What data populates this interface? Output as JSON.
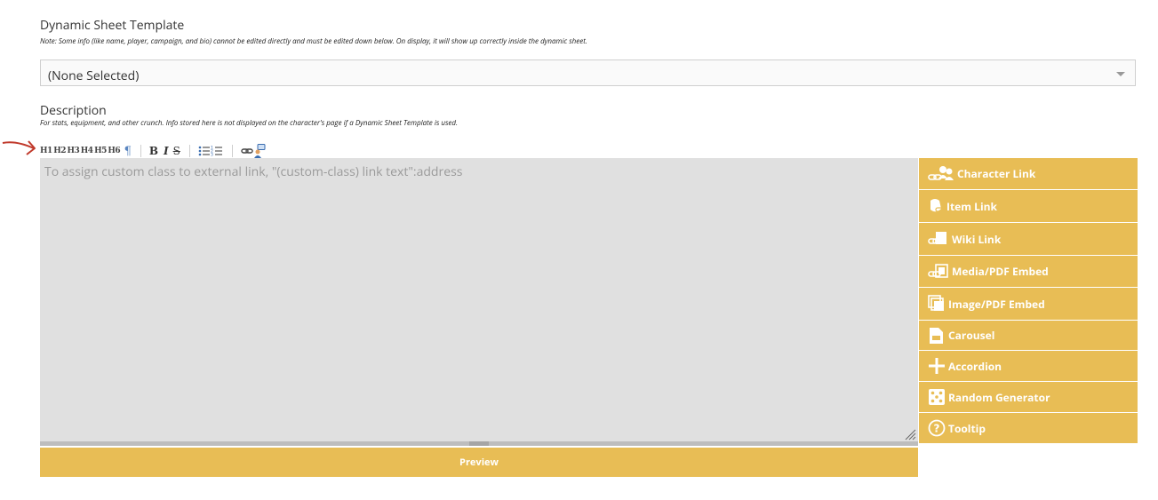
{
  "template": {
    "title": "Dynamic Sheet Template",
    "note": "Note: Some info (like name, player, campaign, and bio) cannot be edited directly and must be edited down below. On display, it will show up correctly inside the dynamic sheet.",
    "selected": "(None Selected)"
  },
  "description": {
    "title": "Description",
    "note": "For stats, equipment, and other crunch. Info stored here is not displayed on the character's page if a Dynamic Sheet Template is used."
  },
  "toolbar": {
    "headings": [
      "H1",
      "H2",
      "H3",
      "H4",
      "H5",
      "H6"
    ],
    "pilcrow": "¶",
    "bold": "B",
    "italic": "I",
    "strike": "S"
  },
  "editor": {
    "placeholder": "To assign custom class to external link, \"(custom-class) link text\":address"
  },
  "preview_label": "Preview",
  "side_buttons": [
    {
      "label": "Character Link",
      "icon": "character-link-icon"
    },
    {
      "label": "Item Link",
      "icon": "item-link-icon"
    },
    {
      "label": "Wiki Link",
      "icon": "wiki-link-icon"
    },
    {
      "label": "Media/PDF Embed",
      "icon": "media-embed-icon"
    },
    {
      "label": "Image/PDF Embed",
      "icon": "image-embed-icon"
    },
    {
      "label": "Carousel",
      "icon": "carousel-icon"
    },
    {
      "label": "Accordion",
      "icon": "plus-icon"
    },
    {
      "label": "Random Generator",
      "icon": "dice-icon"
    },
    {
      "label": "Tooltip",
      "icon": "question-icon"
    }
  ],
  "colors": {
    "accent": "#e8bd55",
    "editor_bg": "#e0e0e0",
    "annotation_arrow": "#c0392b"
  }
}
